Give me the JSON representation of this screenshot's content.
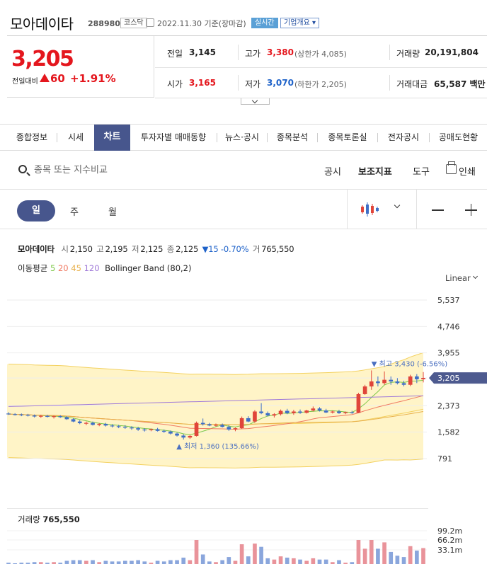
{
  "header": {
    "name": "모아데이타",
    "code": "288980",
    "market": "코스닥",
    "date": "2022.11.30",
    "basis": "기준(장마감)",
    "realtime": "실시간",
    "company_btn": "기업개요"
  },
  "price": {
    "current": "3,205",
    "change_label": "전일대비",
    "change": "60",
    "change_pct": "+1.91%"
  },
  "quote": {
    "prev_label": "전일",
    "prev": "3,145",
    "high_label": "고가",
    "high": "3,380",
    "upper_limit": "(상한가 4,085)",
    "volume_label": "거래량",
    "volume": "20,191,804",
    "open_label": "시가",
    "open": "3,165",
    "low_label": "저가",
    "low": "3,070",
    "lower_limit": "(하한가 2,205)",
    "amount_label": "거래대금",
    "amount": "65,587 백만"
  },
  "tabs": [
    "종합정보",
    "시세",
    "차트",
    "투자자별 매매동향",
    "뉴스·공시",
    "종목분석",
    "종목토론실",
    "전자공시",
    "공매도현황"
  ],
  "toolbar": {
    "search_placeholder": "종목 또는 지수비교",
    "notice": "공시",
    "indicator": "보조지표",
    "tools": "도구",
    "print": "인쇄"
  },
  "periods": {
    "day": "일",
    "week": "주",
    "month": "월"
  },
  "legend": {
    "name": "모아데이타",
    "o_lbl": "시",
    "o": "2,150",
    "h_lbl": "고",
    "h": "2,195",
    "l_lbl": "저",
    "l": "2,125",
    "c_lbl": "종",
    "c": "2,125",
    "chg": "▼15 -0.70%",
    "v_lbl": "거",
    "v": "765,550",
    "ma_label": "이동평균",
    "ma5": "5",
    "ma20": "20",
    "ma45": "45",
    "ma120": "120",
    "bb": "Bollinger Band (80,2)",
    "scale": "Linear"
  },
  "chart_data": {
    "type": "candlestick",
    "y_ticks": [
      "5,537",
      "4,746",
      "3,955",
      "3,205",
      "2,373",
      "1,582",
      "791"
    ],
    "ylim": [
      300,
      6000
    ],
    "current_label": "3,205",
    "max_label": "최고 3,430 (-6.56%)",
    "min_label": "최저 1,360 (135.66%)",
    "colors": {
      "up": "#e0453a",
      "down": "#3f6fc6",
      "ma5": "#7ec84a",
      "ma20": "#f07a63",
      "ma45": "#e8b04a",
      "ma120": "#a07ad8",
      "bb_fill": "#fff4c7",
      "bb_line": "#f3d160"
    },
    "ohlc": [
      [
        2140,
        2180,
        2100,
        2120
      ],
      [
        2120,
        2150,
        2080,
        2110
      ],
      [
        2110,
        2140,
        2060,
        2100
      ],
      [
        2100,
        2130,
        2050,
        2080
      ],
      [
        2080,
        2110,
        2020,
        2050
      ],
      [
        2050,
        2100,
        2010,
        2070
      ],
      [
        2070,
        2100,
        2020,
        2040
      ],
      [
        2040,
        2080,
        1990,
        2060
      ],
      [
        2060,
        2090,
        2010,
        2030
      ],
      [
        2030,
        2060,
        1950,
        1970
      ],
      [
        1970,
        2000,
        1880,
        1900
      ],
      [
        1900,
        1940,
        1820,
        1850
      ],
      [
        1850,
        1900,
        1790,
        1860
      ],
      [
        1860,
        1900,
        1780,
        1800
      ],
      [
        1800,
        1850,
        1760,
        1830
      ],
      [
        1830,
        1860,
        1750,
        1780
      ],
      [
        1780,
        1820,
        1720,
        1760
      ],
      [
        1760,
        1800,
        1700,
        1740
      ],
      [
        1740,
        1790,
        1680,
        1720
      ],
      [
        1720,
        1760,
        1650,
        1700
      ],
      [
        1700,
        1740,
        1620,
        1660
      ],
      [
        1660,
        1700,
        1600,
        1640
      ],
      [
        1640,
        1690,
        1610,
        1670
      ],
      [
        1670,
        1710,
        1600,
        1620
      ],
      [
        1620,
        1660,
        1560,
        1600
      ],
      [
        1600,
        1630,
        1510,
        1540
      ],
      [
        1540,
        1570,
        1450,
        1480
      ],
      [
        1480,
        1520,
        1360,
        1420
      ],
      [
        1420,
        1500,
        1380,
        1470
      ],
      [
        1470,
        1900,
        1450,
        1860
      ],
      [
        1860,
        1990,
        1780,
        1820
      ],
      [
        1820,
        1860,
        1760,
        1780
      ],
      [
        1780,
        1840,
        1750,
        1800
      ],
      [
        1800,
        1840,
        1720,
        1740
      ],
      [
        1740,
        1790,
        1620,
        1660
      ],
      [
        1660,
        1720,
        1610,
        1700
      ],
      [
        1700,
        2050,
        1680,
        2000
      ],
      [
        2000,
        2060,
        1880,
        1900
      ],
      [
        1900,
        2240,
        1860,
        2200
      ],
      [
        2200,
        2450,
        2120,
        2150
      ],
      [
        2150,
        2200,
        2050,
        2080
      ],
      [
        2080,
        2150,
        2020,
        2120
      ],
      [
        2120,
        2260,
        2080,
        2220
      ],
      [
        2220,
        2280,
        2120,
        2150
      ],
      [
        2150,
        2250,
        2100,
        2200
      ],
      [
        2200,
        2260,
        2130,
        2160
      ],
      [
        2160,
        2250,
        2140,
        2230
      ],
      [
        2230,
        2350,
        2200,
        2290
      ],
      [
        2290,
        2330,
        2200,
        2230
      ],
      [
        2230,
        2280,
        2150,
        2170
      ],
      [
        2170,
        2230,
        2140,
        2200
      ],
      [
        2200,
        2250,
        2130,
        2150
      ],
      [
        2150,
        2200,
        2120,
        2180
      ],
      [
        2180,
        2220,
        2130,
        2160
      ],
      [
        2160,
        2760,
        2150,
        2720
      ],
      [
        2720,
        3000,
        2700,
        2950
      ],
      [
        2950,
        3430,
        2850,
        3100
      ],
      [
        3100,
        3250,
        2950,
        3050
      ],
      [
        3050,
        3400,
        3000,
        3150
      ],
      [
        3150,
        3250,
        3000,
        3100
      ],
      [
        3100,
        3200,
        3010,
        3050
      ],
      [
        3050,
        3120,
        2950,
        3000
      ],
      [
        3000,
        3300,
        2960,
        3250
      ],
      [
        3250,
        3320,
        3050,
        3165
      ],
      [
        3165,
        3380,
        3070,
        3205
      ]
    ],
    "volume": [
      0,
      0,
      0,
      0,
      0,
      0,
      0,
      0,
      0,
      0,
      0,
      0,
      0,
      0,
      0,
      0,
      0,
      0,
      0,
      0,
      0,
      0,
      0,
      0,
      0,
      0,
      0,
      0,
      0,
      0,
      0,
      0,
      0,
      0,
      0,
      0,
      0,
      0,
      0,
      0,
      0,
      0,
      0,
      0,
      0,
      0,
      0,
      0,
      0,
      0,
      0,
      0,
      0,
      0,
      0,
      0,
      0,
      0,
      0,
      0,
      0,
      0,
      0,
      0,
      0
    ],
    "volume_ticks": [
      "99.2m",
      "66.2m",
      "33.1m"
    ],
    "volume_label": "거래량",
    "volume_value": "765,550"
  }
}
